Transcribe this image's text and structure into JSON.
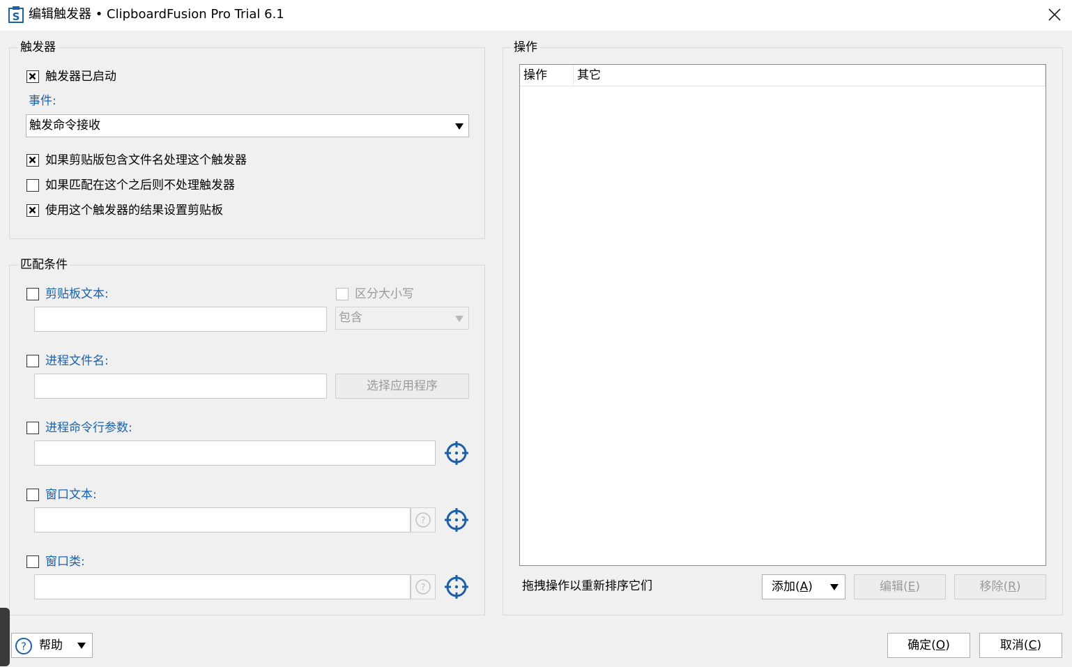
{
  "window": {
    "title": "编辑触发器 • ClipboardFusion Pro Trial 6.1"
  },
  "trigger_group": {
    "label": "触发器",
    "enabled_label": "触发器已启动",
    "enabled_checked": true,
    "event_label": "事件:",
    "event_value": "触发命令接收",
    "options": [
      {
        "label": "如果剪贴版包含文件名处理这个触发器",
        "checked": true
      },
      {
        "label": "如果匹配在这个之后则不处理触发器",
        "checked": false
      },
      {
        "label": "使用这个触发器的结果设置剪贴板",
        "checked": true
      }
    ]
  },
  "match_group": {
    "label": "匹配条件",
    "clipboard_text": {
      "label": "剪贴板文本:",
      "value": ""
    },
    "case_sensitive": {
      "label": "区分大小写"
    },
    "match_mode": {
      "value": "包含"
    },
    "process_name": {
      "label": "进程文件名:",
      "value": ""
    },
    "choose_app_label": "选择应用程序",
    "process_args": {
      "label": "进程命令行参数:",
      "value": ""
    },
    "window_text": {
      "label": "窗口文本:",
      "value": ""
    },
    "window_class": {
      "label": "窗口类:",
      "value": ""
    }
  },
  "actions_group": {
    "label": "操作",
    "columns": [
      "操作",
      "其它"
    ],
    "hint": "拖拽操作以重新排序它们",
    "add_button": {
      "text": "添加",
      "key": "A"
    },
    "edit_button": {
      "text": "编辑",
      "key": "E"
    },
    "remove_button": {
      "text": "移除",
      "key": "R"
    }
  },
  "footer": {
    "help_label": "帮助",
    "ok_button": {
      "text": "确定",
      "key": "O"
    },
    "cancel_button": {
      "text": "取消",
      "key": "C"
    }
  },
  "colors": {
    "accent_blue": "#1c61a8",
    "target_icon": "#1a5fa8"
  }
}
